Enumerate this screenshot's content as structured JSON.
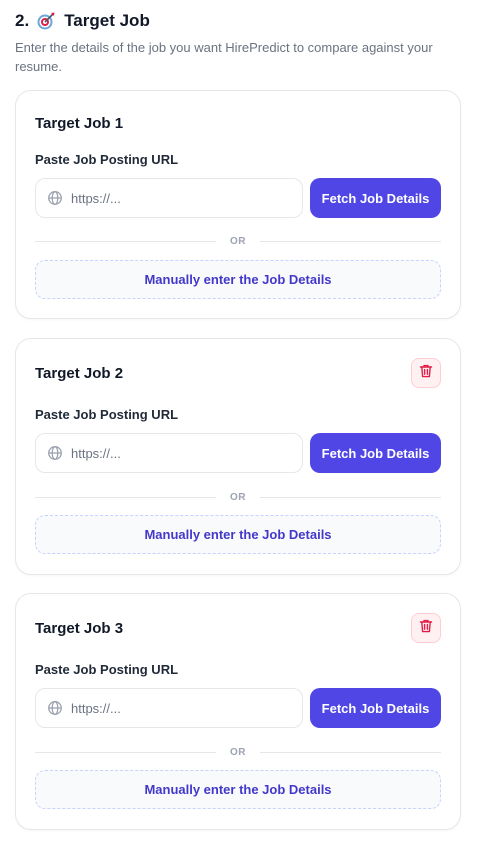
{
  "section": {
    "number": "2.",
    "title": "Target Job",
    "icon": "target-icon",
    "description": "Enter the details of the job you want HirePredict to compare against your resume."
  },
  "colors": {
    "primary": "#4f46e5",
    "manual_text": "#4338ca",
    "delete_icon": "#e11d48",
    "delete_bg": "#fff1f2"
  },
  "jobs": [
    {
      "title": "Target Job 1",
      "url_label": "Paste Job Posting URL",
      "url_value": "",
      "url_placeholder": "https://...",
      "fetch_label": "Fetch Job Details",
      "or_label": "OR",
      "manual_label": "Manually enter the Job Details",
      "deletable": false
    },
    {
      "title": "Target Job 2",
      "url_label": "Paste Job Posting URL",
      "url_value": "",
      "url_placeholder": "https://...",
      "fetch_label": "Fetch Job Details",
      "or_label": "OR",
      "manual_label": "Manually enter the Job Details",
      "deletable": true,
      "delete_icon": "trash-icon"
    },
    {
      "title": "Target Job 3",
      "url_label": "Paste Job Posting URL",
      "url_value": "",
      "url_placeholder": "https://...",
      "fetch_label": "Fetch Job Details",
      "or_label": "OR",
      "manual_label": "Manually enter the Job Details",
      "deletable": true,
      "delete_icon": "trash-icon"
    }
  ]
}
